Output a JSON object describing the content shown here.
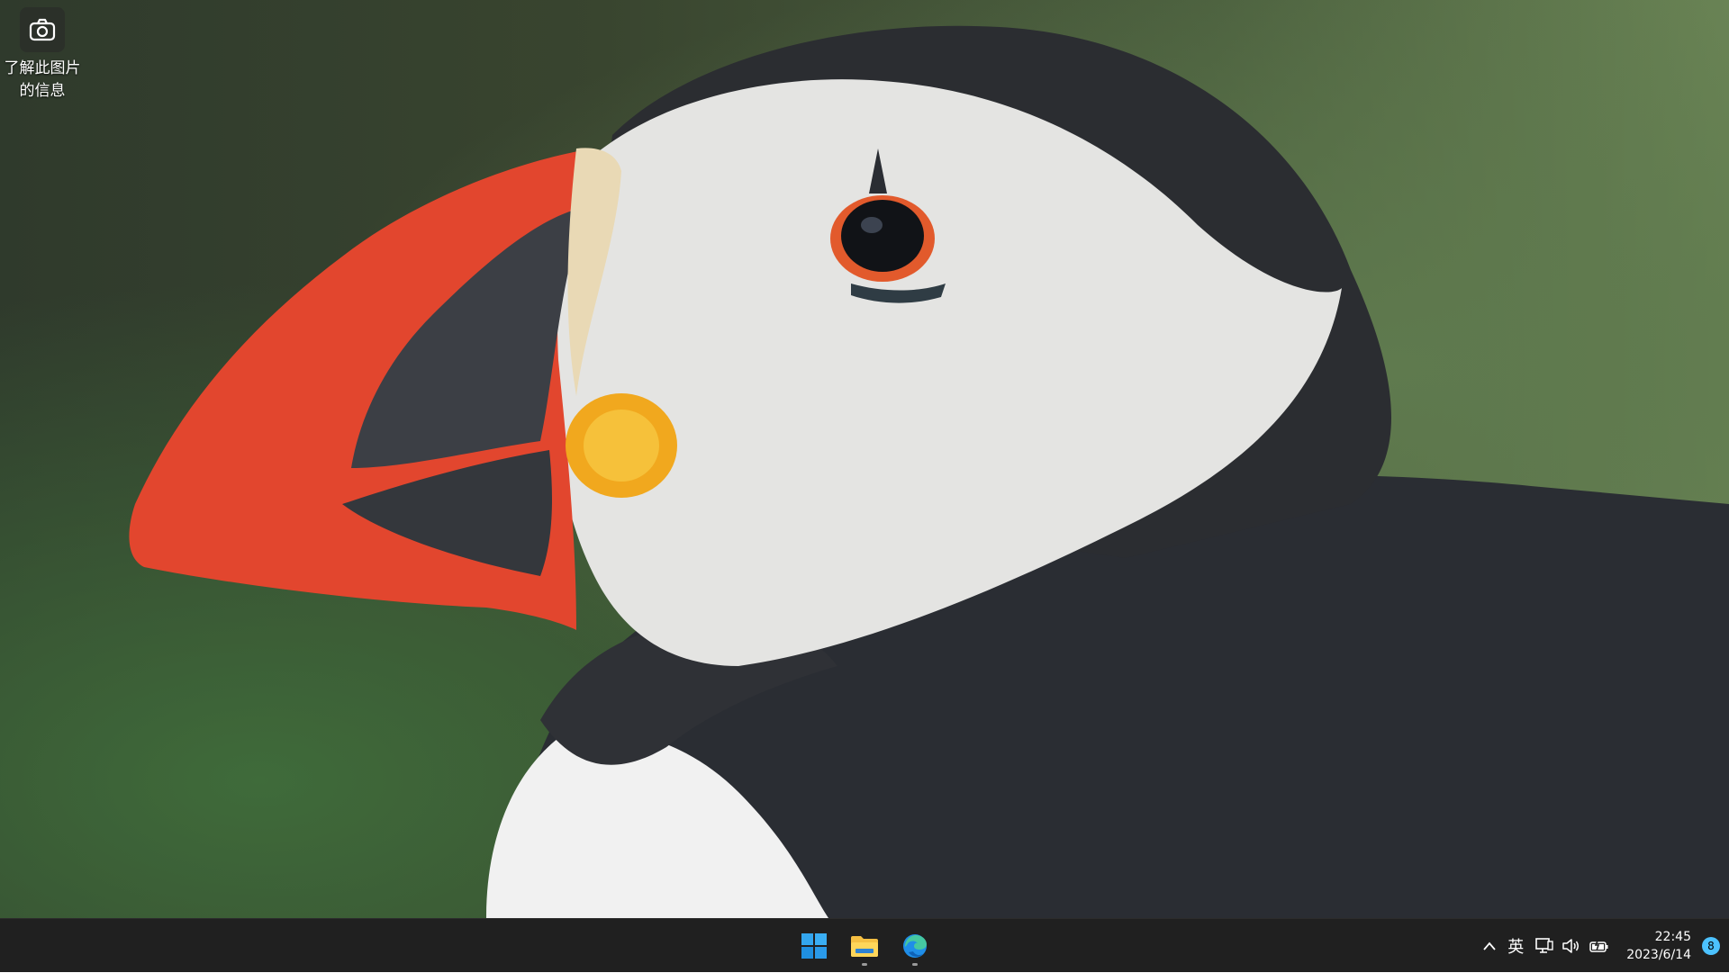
{
  "desktop": {
    "icon": {
      "name": "camera-icon",
      "label_line1": "了解此图片",
      "label_line2": "的信息"
    }
  },
  "taskbar": {
    "apps": [
      {
        "name": "windows-start-icon"
      },
      {
        "name": "file-explorer-icon"
      },
      {
        "name": "edge-browser-icon"
      }
    ],
    "tray": {
      "overflow_icon": "chevron-up-icon",
      "ime": "英",
      "network_icon": "network-icon",
      "volume_icon": "speaker-icon",
      "battery_icon": "battery-icon"
    },
    "clock": {
      "time": "22:45",
      "date": "2023/6/14"
    },
    "notification_count": "8"
  },
  "colors": {
    "taskbar_bg": "#202020",
    "accent": "#4cc2ff"
  }
}
